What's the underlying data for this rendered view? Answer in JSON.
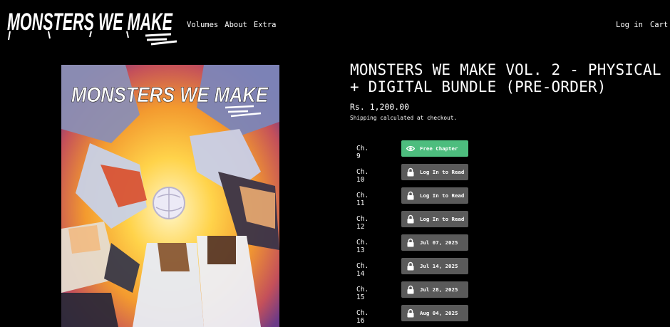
{
  "header": {
    "logo_text": "MONSTERS WE MAKE",
    "nav": [
      "Volumes",
      "About",
      "Extra"
    ],
    "login_label": "Log in",
    "cart_label": "Cart ("
  },
  "product": {
    "cover_title": "MONSTERS WE MAKE",
    "title": "MONSTERS WE MAKE VOL. 2 - PHYSICAL + DIGITAL BUNDLE (PRE-ORDER)",
    "price": "Rs. 1,200.00",
    "shipping_note": "Shipping calculated at checkout."
  },
  "chapters": [
    {
      "label": "Ch. 9",
      "action": "Free Chapter",
      "icon": "eye-icon",
      "status": "free"
    },
    {
      "label": "Ch. 10",
      "action": "Log In to Read",
      "icon": "lock-icon",
      "status": "locked"
    },
    {
      "label": "Ch. 11",
      "action": "Log In to Read",
      "icon": "lock-icon",
      "status": "locked"
    },
    {
      "label": "Ch. 12",
      "action": "Log In to Read",
      "icon": "lock-icon",
      "status": "locked"
    },
    {
      "label": "Ch. 13",
      "action": "Jul 07, 2025",
      "icon": "lock-icon",
      "status": "scheduled"
    },
    {
      "label": "Ch. 14",
      "action": "Jul 14, 2025",
      "icon": "lock-icon",
      "status": "scheduled"
    },
    {
      "label": "Ch. 15",
      "action": "Jul 28, 2025",
      "icon": "lock-icon",
      "status": "scheduled"
    },
    {
      "label": "Ch. 16",
      "action": "Aug 04, 2025",
      "icon": "lock-icon",
      "status": "scheduled"
    }
  ],
  "colors": {
    "background": "#000000",
    "free_button": "#4dbd7e",
    "locked_button": "#5a5a5a",
    "text": "#ffffff"
  }
}
